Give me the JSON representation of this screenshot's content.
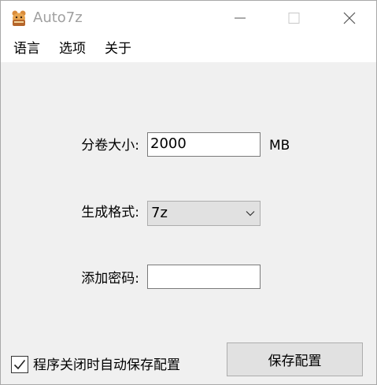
{
  "window": {
    "title": "Auto7z",
    "icons": {
      "app": "app-icon",
      "minimize": "minimize-icon",
      "maximize": "maximize-icon",
      "close": "close-icon"
    }
  },
  "menu": {
    "items": [
      "语言",
      "选项",
      "关于"
    ]
  },
  "form": {
    "volume_size_label": "分卷大小:",
    "volume_size_value": "2000",
    "volume_size_unit": "MB",
    "format_label": "生成格式:",
    "format_value": "7z",
    "password_label": "添加密码:",
    "password_value": ""
  },
  "footer": {
    "autosave_label": "程序关闭时自动保存配置",
    "autosave_checked": true,
    "save_button": "保存配置"
  }
}
